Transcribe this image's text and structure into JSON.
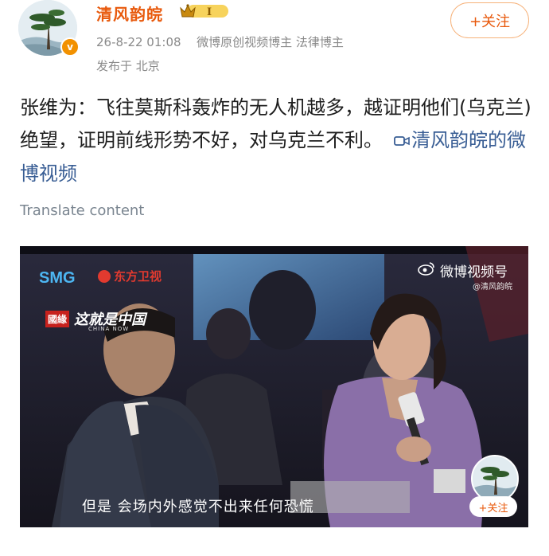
{
  "post": {
    "author": {
      "name": "清风韵皖",
      "vip_level": "I",
      "verified_badge": "v"
    },
    "date": "26-8-22 01:08",
    "source_tag": "微博原创视频博主 法律博主",
    "location": "发布于 北京",
    "follow_label": "+关注",
    "text": "张维为：飞往莫斯科轰炸的无人机越多，越证明他们(乌克兰)绝望，证明前线形势不好，对乌克兰不利。",
    "video_link_label": "清风韵皖的微博视频",
    "translate_label": "Translate content"
  },
  "video": {
    "broadcaster": "SMG",
    "channel": "东方卫视",
    "platform_label": "微博视频号",
    "platform_handle": "@清风韵皖",
    "show_seal": "國緣",
    "show_name": "这就是中国",
    "show_subtitle": "CHINA NOW",
    "subtitle_text": "但是 会场内外感觉不出来任何恐慌",
    "mini_follow_label": "+关注"
  },
  "colors": {
    "accent": "#e8590c",
    "link": "#385d94",
    "meta": "#8a8a8a"
  }
}
